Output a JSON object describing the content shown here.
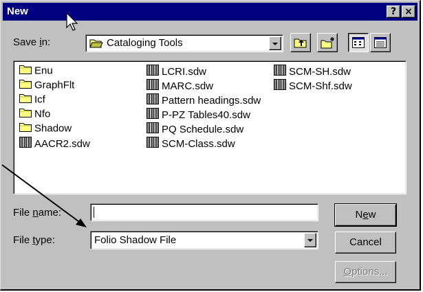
{
  "dialog": {
    "title": "New",
    "help_button": "?",
    "close_button": "×"
  },
  "save_in": {
    "label_pre": "Save ",
    "label_accel": "i",
    "label_post": "n:",
    "value": "Cataloging Tools"
  },
  "files": {
    "col1": [
      {
        "name": "Enu",
        "type": "folder"
      },
      {
        "name": "GraphFlt",
        "type": "folder"
      },
      {
        "name": "Icf",
        "type": "folder"
      },
      {
        "name": "Nfo",
        "type": "folder"
      },
      {
        "name": "Shadow",
        "type": "folder"
      },
      {
        "name": "AACR2.sdw",
        "type": "book"
      }
    ],
    "col2": [
      {
        "name": "LCRI.sdw",
        "type": "book"
      },
      {
        "name": "MARC.sdw",
        "type": "book"
      },
      {
        "name": "Pattern headings.sdw",
        "type": "book"
      },
      {
        "name": "P-PZ Tables40.sdw",
        "type": "book"
      },
      {
        "name": "PQ Schedule.sdw",
        "type": "book"
      },
      {
        "name": "SCM-Class.sdw",
        "type": "book"
      }
    ],
    "col3": [
      {
        "name": "SCM-SH.sdw",
        "type": "book"
      },
      {
        "name": "SCM-Shf.sdw",
        "type": "book"
      }
    ]
  },
  "file_name": {
    "label_pre": "File ",
    "label_accel": "n",
    "label_post": "ame:",
    "value": ""
  },
  "file_type": {
    "label_pre": "File ",
    "label_accel": "t",
    "label_post": "ype:",
    "value": "Folio Shadow File"
  },
  "buttons": {
    "new_pre": "N",
    "new_accel": "e",
    "new_post": "w",
    "cancel": "Cancel",
    "options_accel": "O",
    "options_post": "ptions..."
  },
  "colors": {
    "titlebar": "#000080",
    "face": "#c0c0c0",
    "folder": "#ffff80",
    "book": "#808080"
  }
}
